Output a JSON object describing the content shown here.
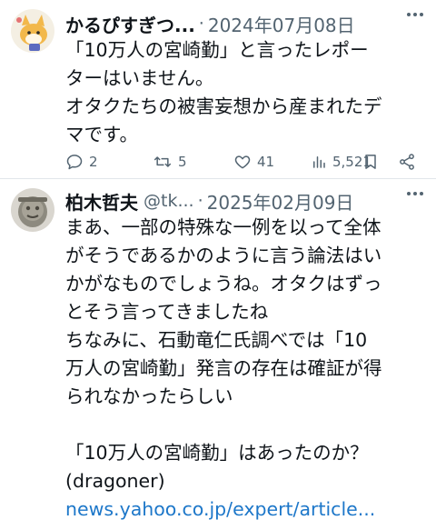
{
  "tweets": [
    {
      "name": "かるぴすぎつ...",
      "handle": "",
      "dot": "·",
      "date": "2024年07月08日",
      "lines": [
        "「10万人の宮崎勤」と言ったレポー",
        "ターはいません。",
        "オタクたちの被害妄想から産まれたデ",
        "マです。"
      ],
      "stats": {
        "replies": "2",
        "retweets": "5",
        "likes": "41",
        "views": "5,521"
      },
      "icons": [
        "reply-icon",
        "retweet-icon",
        "like-icon",
        "views-icon",
        "bookmark-icon",
        "share-icon"
      ]
    },
    {
      "name": "柏木哲夫",
      "handle": "@tk...",
      "dot": "·",
      "date": "2025年02月09日",
      "lines": [
        "まあ、一部の特殊な一例を以って全体",
        "がそうであるかのように言う論法はい",
        "かがなものでしょうね。オタクはずっ",
        "とそう言ってきましたね",
        "ちなみに、石動竜仁氏調べでは「10",
        "万人の宮崎勤」発言の存在は確証が得",
        "られなかったらしい"
      ],
      "card_title": "「10万人の宮崎勤」はあったのか？",
      "card_source": "(dragoner)",
      "card_link": "news.yahoo.co.jp/expert/article..."
    }
  ],
  "colors": {
    "text": "#0f1419",
    "secondary": "#536471",
    "link": "#1d77c9",
    "divider": "#e1e6ea"
  }
}
